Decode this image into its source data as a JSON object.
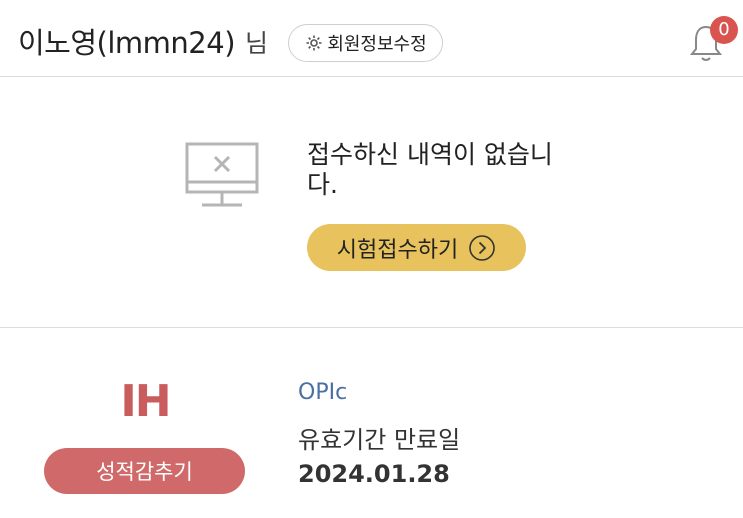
{
  "header": {
    "user_name": "이노영(lmmn24)",
    "honorific": "님",
    "profile_edit_label": "회원정보수정",
    "notification_count": "0"
  },
  "empty_state": {
    "message": "접수하신 내역이 없습니다.",
    "apply_button_label": "시험접수하기"
  },
  "result": {
    "grade": "IH",
    "hide_button_label": "성적감추기",
    "exam_name": "OPIc",
    "expiry_label": "유효기간 만료일",
    "expiry_date": "2024.01.28"
  },
  "colors": {
    "accent_yellow": "#e8c25c",
    "grade_red": "#c95c5c",
    "hide_button": "#d06a6a",
    "exam_blue": "#4a6fa5",
    "badge_red": "#d9534f"
  },
  "icons": [
    "gear-icon",
    "bell-icon",
    "monitor-x-icon",
    "circle-arrow-right-icon"
  ]
}
